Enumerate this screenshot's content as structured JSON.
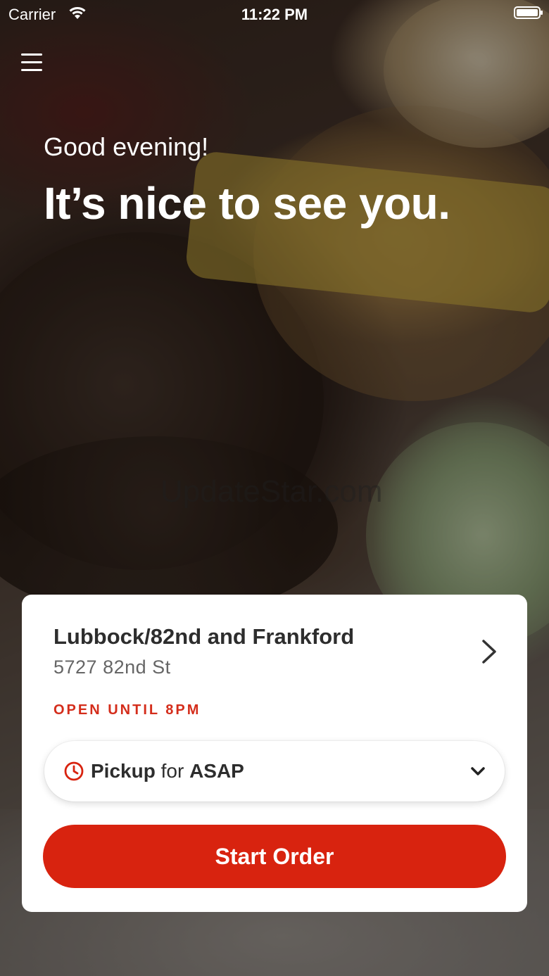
{
  "status_bar": {
    "carrier": "Carrier",
    "time": "11:22 PM"
  },
  "hero": {
    "greeting": "Good evening!",
    "headline": "It’s nice to see you."
  },
  "watermark": "UpdateStar.com",
  "store": {
    "name": "Lubbock/82nd and Frankford",
    "address": "5727 82nd St",
    "hours": "OPEN UNTIL 8PM"
  },
  "order_mode": {
    "mode": "Pickup",
    "connector": "for",
    "time": "ASAP"
  },
  "start_order_label": "Start Order",
  "colors": {
    "accent": "#d8230f",
    "hours_text": "#d42d1b"
  },
  "icons": [
    "menu-icon",
    "wifi-icon",
    "battery-icon",
    "chevron-right-icon",
    "clock-icon",
    "chevron-down-icon"
  ]
}
